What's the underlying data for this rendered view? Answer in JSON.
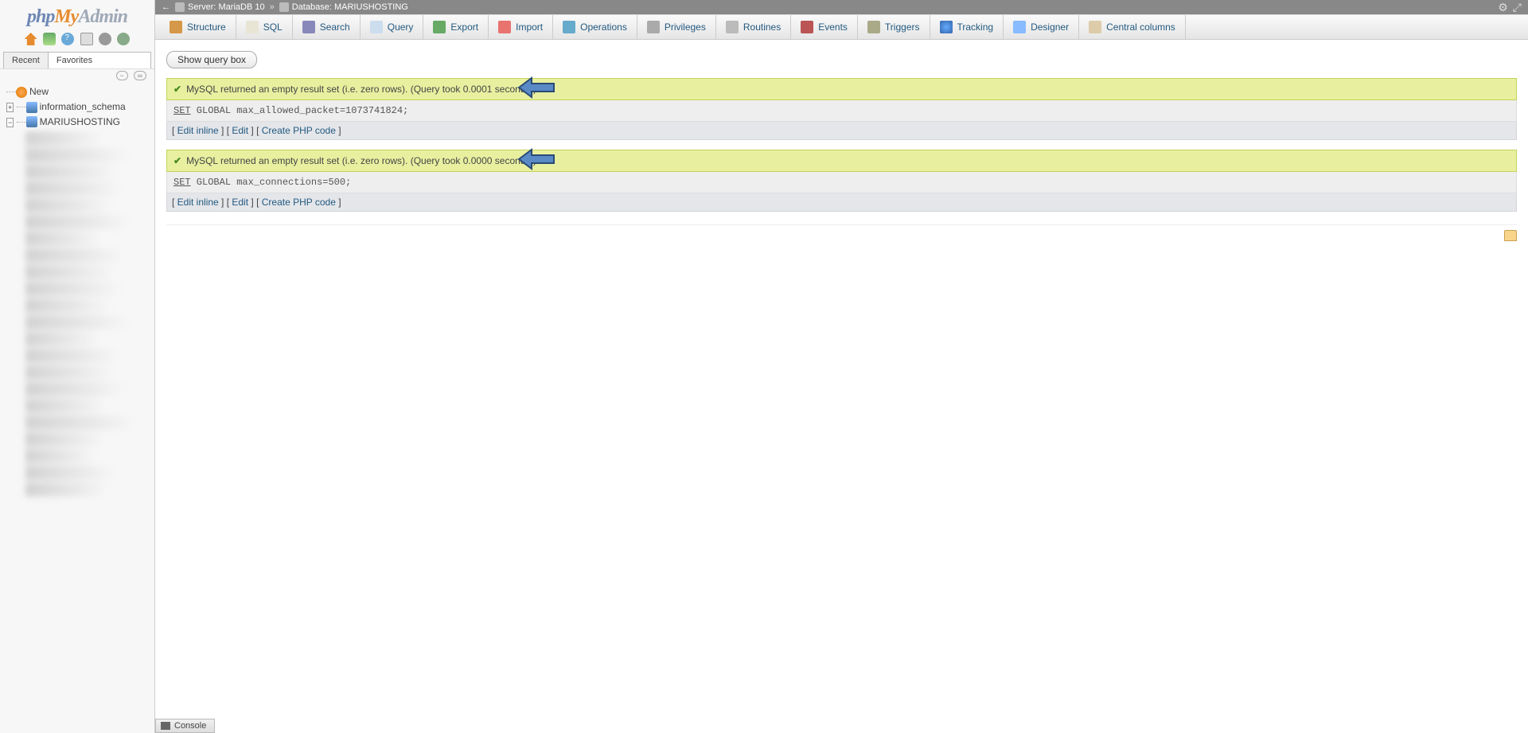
{
  "logo": {
    "p1": "php",
    "p2": "My",
    "p3": "Admin"
  },
  "nav": {
    "tabs": {
      "recent": "Recent",
      "favorites": "Favorites"
    },
    "collapse": "−",
    "link": "∞",
    "tree": {
      "new": "New",
      "db1": "information_schema",
      "db2": "MARIUSHOSTING"
    }
  },
  "breadcrumb": {
    "back": "←",
    "server_label": "Server:",
    "server": "MariaDB 10",
    "sep": "»",
    "database_label": "Database:",
    "database": "MARIUSHOSTING",
    "gear": "⚙",
    "collapse": "⤢"
  },
  "tabs": [
    {
      "name": "structure",
      "label": "Structure"
    },
    {
      "name": "sql",
      "label": "SQL"
    },
    {
      "name": "search",
      "label": "Search"
    },
    {
      "name": "query",
      "label": "Query"
    },
    {
      "name": "export",
      "label": "Export"
    },
    {
      "name": "import",
      "label": "Import"
    },
    {
      "name": "operations",
      "label": "Operations"
    },
    {
      "name": "privileges",
      "label": "Privileges"
    },
    {
      "name": "routines",
      "label": "Routines"
    },
    {
      "name": "events",
      "label": "Events"
    },
    {
      "name": "triggers",
      "label": "Triggers"
    },
    {
      "name": "tracking",
      "label": "Tracking"
    },
    {
      "name": "designer",
      "label": "Designer"
    },
    {
      "name": "central",
      "label": "Central columns"
    }
  ],
  "show_query_box": "Show query box",
  "results": [
    {
      "message": "MySQL returned an empty result set (i.e. zero rows). (Query took 0.0001 seconds.)",
      "sql_kw": "SET",
      "sql_rest": " GLOBAL max_allowed_packet=1073741824;"
    },
    {
      "message": "MySQL returned an empty result set (i.e. zero rows). (Query took 0.0000 seconds.)",
      "sql_kw": "SET",
      "sql_rest": " GLOBAL max_connections=500;"
    }
  ],
  "links": {
    "edit_inline": "Edit inline",
    "edit": "Edit",
    "create_php": "Create PHP code"
  },
  "console": "Console"
}
